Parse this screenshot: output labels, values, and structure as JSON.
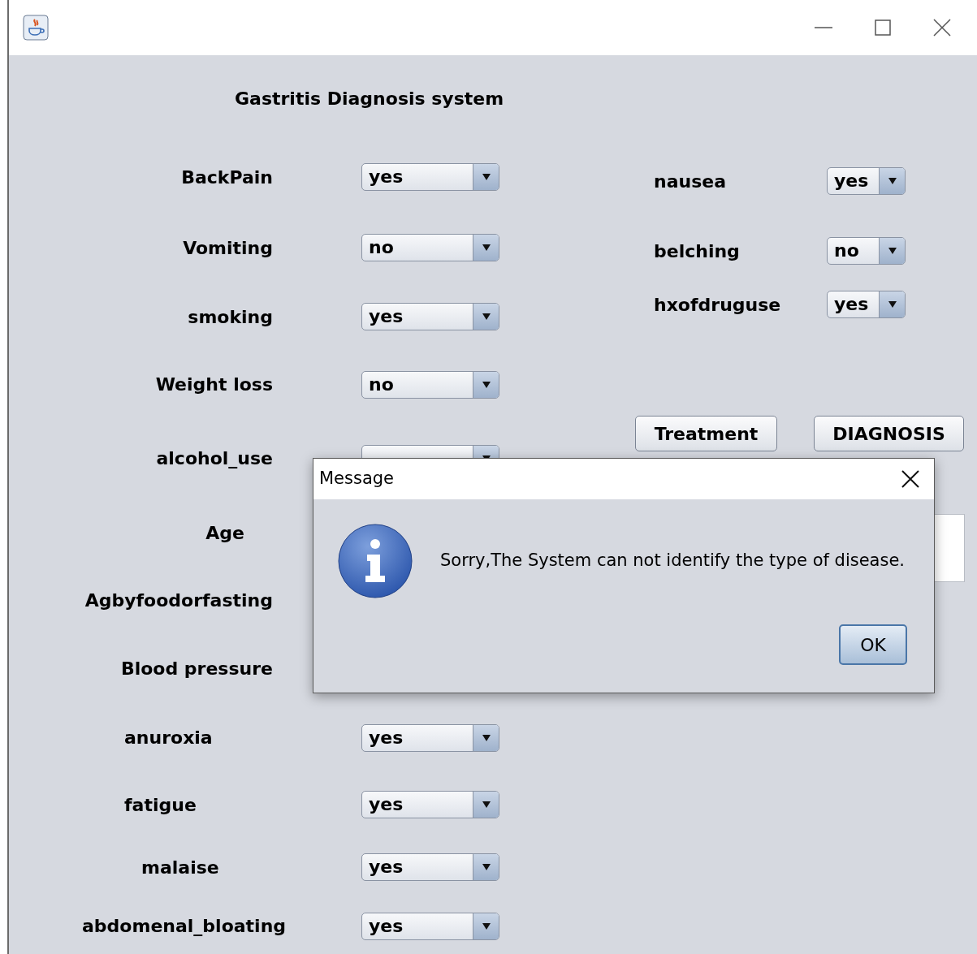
{
  "title": "Gastritis Diagnosis system",
  "left_fields": [
    {
      "label": "BackPain",
      "kind": "select",
      "value": "yes"
    },
    {
      "label": "Vomiting",
      "kind": "select",
      "value": "no"
    },
    {
      "label": "smoking",
      "kind": "select",
      "value": "yes"
    },
    {
      "label": "Weight loss",
      "kind": "select",
      "value": "no"
    },
    {
      "label": "alcohol_use",
      "kind": "select_covered"
    },
    {
      "label": "Age",
      "kind": "label"
    },
    {
      "label": "Agbyfoodorfasting",
      "kind": "label"
    },
    {
      "label": "Blood pressure",
      "kind": "label"
    },
    {
      "label": "anuroxia",
      "kind": "select",
      "value": "yes"
    },
    {
      "label": "fatigue",
      "kind": "select",
      "value": "yes"
    },
    {
      "label": "malaise",
      "kind": "select",
      "value": "yes"
    },
    {
      "label": "abdomenal_bloating",
      "kind": "select",
      "value": "yes"
    }
  ],
  "right_fields": [
    {
      "label": "nausea",
      "value": "yes"
    },
    {
      "label": "belching",
      "value": "no"
    },
    {
      "label": "hxofdruguse",
      "value": "yes"
    }
  ],
  "buttons": [
    "Treatment",
    "DIAGNOSIS"
  ],
  "dialog": {
    "title": "Message",
    "message": "Sorry,The System can not identify the type of disease.",
    "button": "OK"
  }
}
